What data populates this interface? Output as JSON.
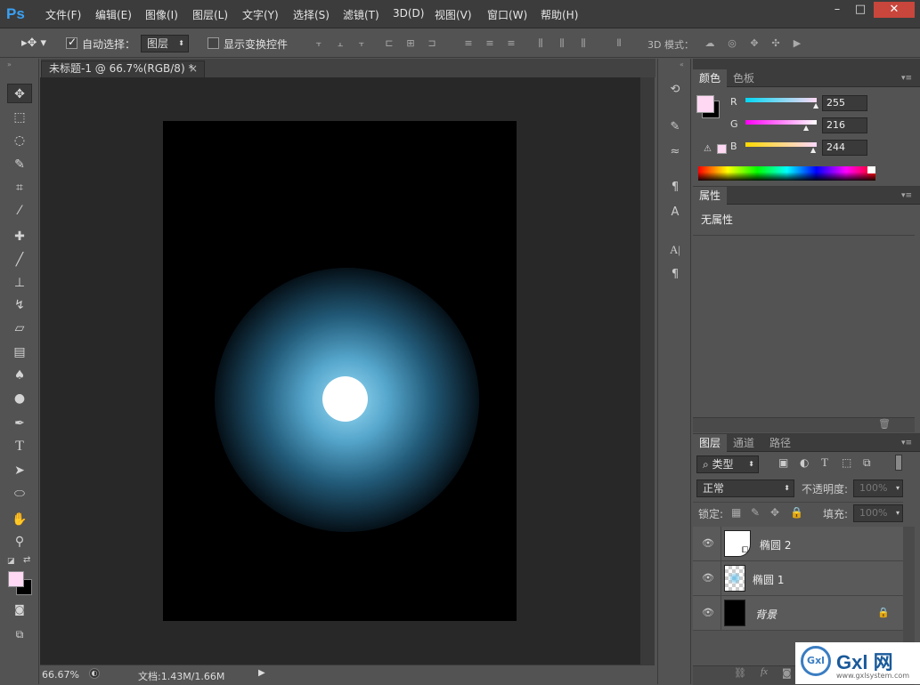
{
  "app": {
    "logo": "Ps"
  },
  "menus": [
    "文件(F)",
    "编辑(E)",
    "图像(I)",
    "图层(L)",
    "文字(Y)",
    "选择(S)",
    "滤镜(T)",
    "3D(D)",
    "视图(V)",
    "窗口(W)",
    "帮助(H)"
  ],
  "window_controls": {
    "minimize": "–",
    "maximize": "□",
    "close": "✕"
  },
  "options": {
    "auto_select_label": "自动选择：",
    "auto_select_checked": true,
    "auto_select_target": "图层",
    "show_transform_label": "显示变换控件",
    "show_transform_checked": false,
    "mode_3d_label": "3D 模式："
  },
  "document": {
    "tab_title": "未标题-1 @ 66.7%(RGB/8) *",
    "tab_close": "×",
    "zoom": "66.67%",
    "doc_info": "文档:1.43M/1.66M",
    "canvas_bg": "#000000",
    "glow_color": "#5ab4dc",
    "moon_color": "#ffffff"
  },
  "color_panel": {
    "tabs": [
      "颜色",
      "色板"
    ],
    "active_tab": 0,
    "fg_color": "#ffd8f4",
    "bg_color": "#000000",
    "channels": [
      {
        "label": "R",
        "value": "255"
      },
      {
        "label": "G",
        "value": "216"
      },
      {
        "label": "B",
        "value": "244"
      }
    ]
  },
  "properties_panel": {
    "tabs": [
      "属性"
    ],
    "content": "无属性"
  },
  "layers_panel": {
    "tabs": [
      "图层",
      "通道",
      "路径"
    ],
    "active_tab": 0,
    "filter_kind": "类型",
    "blend_mode": "正常",
    "opacity_label": "不透明度:",
    "opacity_value": "100%",
    "lock_label": "锁定:",
    "fill_label": "填充:",
    "fill_value": "100%",
    "layers": [
      {
        "name": "椭圆 2",
        "thumb": "white-shape"
      },
      {
        "name": "椭圆 1",
        "thumb": "glow"
      },
      {
        "name": "背景",
        "thumb": "black",
        "locked": true
      }
    ]
  },
  "watermark": {
    "brand": "Gxl 网",
    "url": "www.gxlsystem.com"
  }
}
